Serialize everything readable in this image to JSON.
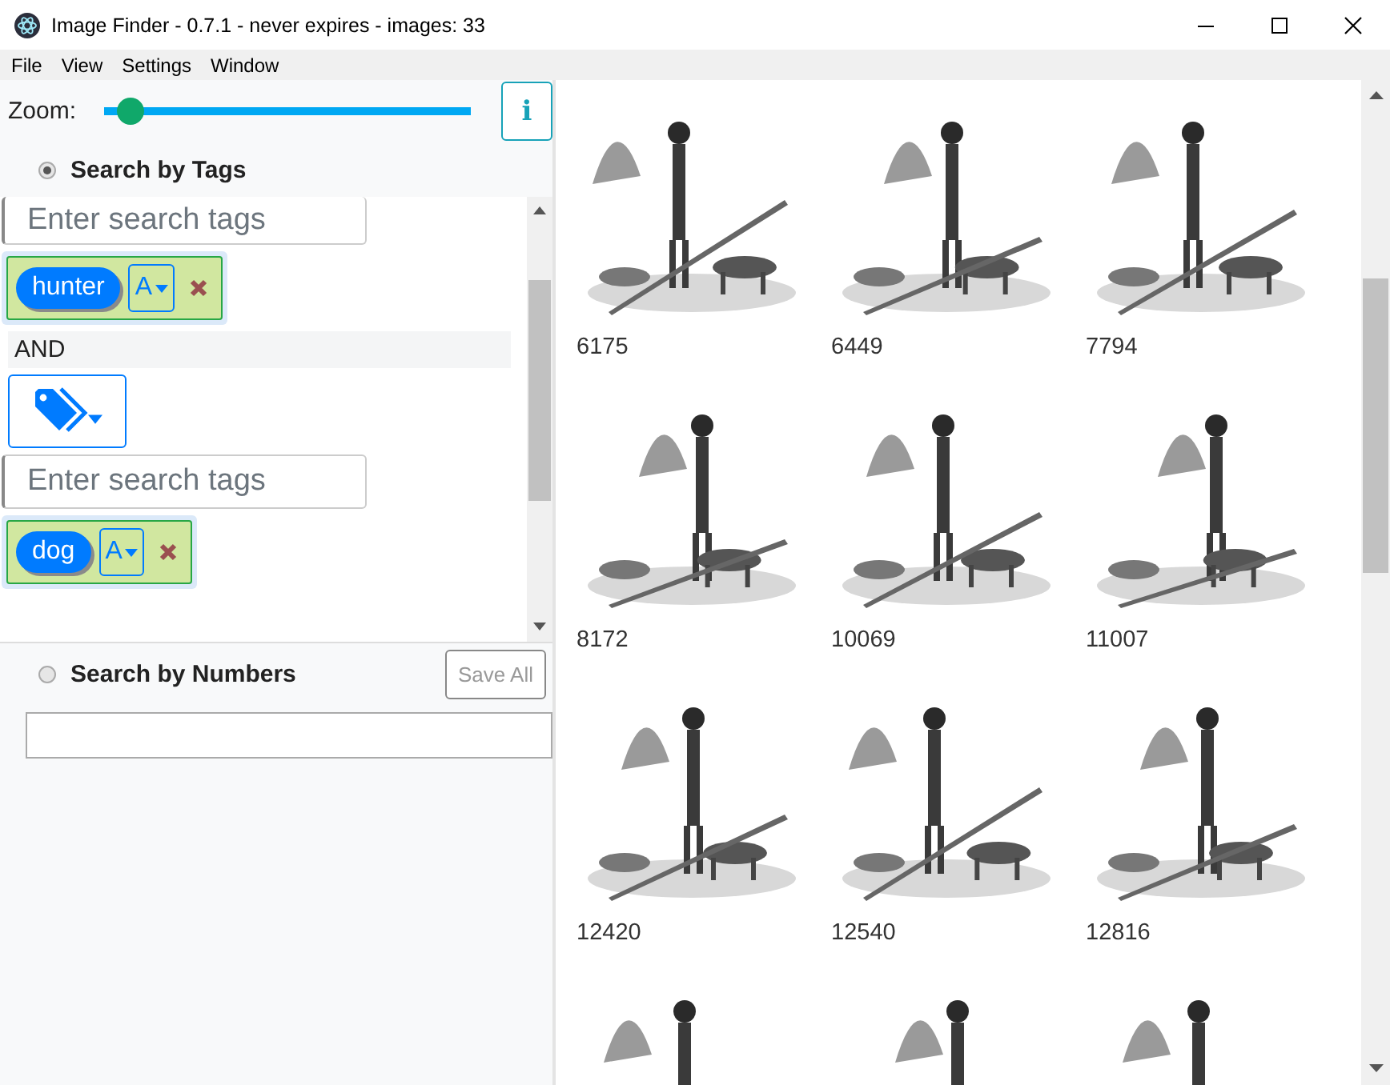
{
  "window": {
    "title": "Image Finder - 0.7.1 - never expires - images: 33"
  },
  "menu": [
    "File",
    "View",
    "Settings",
    "Window"
  ],
  "zoom": {
    "label": "Zoom:",
    "level": 0.07,
    "info_button": "i"
  },
  "search_modes": [
    {
      "label": "Search by Tags",
      "selected": true
    },
    {
      "label": "Search by Numbers",
      "selected": false
    }
  ],
  "tag_query": [
    {
      "kind": "field",
      "placeholder": "Enter search tags"
    },
    {
      "kind": "chip",
      "tag": "hunter",
      "mode": "A"
    },
    {
      "kind": "operator",
      "label": "AND"
    },
    {
      "kind": "tag_button"
    },
    {
      "kind": "field",
      "placeholder": "Enter search tags"
    },
    {
      "kind": "chip",
      "tag": "dog",
      "mode": "A"
    }
  ],
  "save_button": {
    "label": "Save All",
    "disabled": true
  },
  "gallery": [
    {
      "kind": "captioned",
      "label": "6175"
    },
    {
      "kind": "captioned",
      "label": "6449"
    },
    {
      "kind": "captioned",
      "label": "7794"
    },
    {
      "kind": "captioned",
      "label": "8172"
    },
    {
      "kind": "captioned",
      "label": "10069"
    },
    {
      "kind": "captioned",
      "label": "11007"
    },
    {
      "kind": "captioned",
      "label": "12420"
    },
    {
      "kind": "captioned",
      "label": "12540"
    },
    {
      "kind": "captioned",
      "label": "12816"
    },
    {
      "kind": "picture"
    },
    {
      "kind": "picture"
    },
    {
      "kind": "picture"
    }
  ]
}
